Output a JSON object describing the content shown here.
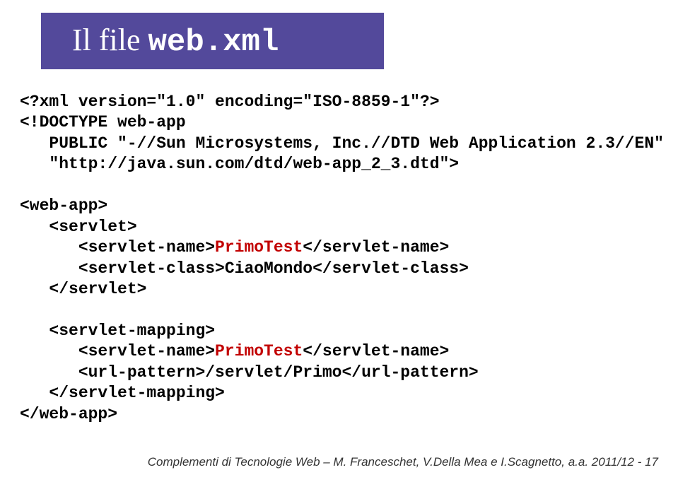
{
  "title": {
    "prefix": "Il file ",
    "filename": "web.xml"
  },
  "code": {
    "l1": "<?xml version=\"1.0\" encoding=\"ISO-8859-1\"?>",
    "l2a": "<!DOCTYPE web-app",
    "l2b": "   PUBLIC \"-//Sun Microsystems, Inc.//DTD Web Application 2.3//EN\"",
    "l2c": "   \"http://java.sun.com/dtd/web-app_2_3.dtd\">",
    "l3": "<web-app>",
    "l4": "   <servlet>",
    "l5a": "      <servlet-name>",
    "l5b": "PrimoTest",
    "l5c": "</servlet-name>",
    "l6": "      <servlet-class>CiaoMondo</servlet-class>",
    "l7": "   </servlet>",
    "l8": "   <servlet-mapping>",
    "l9a": "      <servlet-name>",
    "l9b": "PrimoTest",
    "l9c": "</servlet-name>",
    "l10": "      <url-pattern>/servlet/Primo</url-pattern>",
    "l11": "   </servlet-mapping>",
    "l12": "</web-app>"
  },
  "footer": "Complementi di Tecnologie Web – M. Franceschet, V.Della Mea e I.Scagnetto, a.a. 2011/12 - 17"
}
